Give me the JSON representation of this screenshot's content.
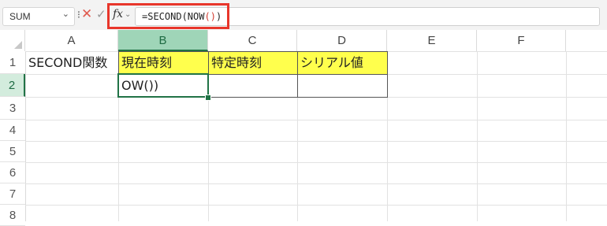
{
  "formula_bar": {
    "name_box": "SUM",
    "formula_prefix": "=SECOND(NOW",
    "formula_parens": "()",
    "formula_suffix": ")",
    "fx_label": "fx"
  },
  "columns": [
    "A",
    "B",
    "C",
    "D",
    "E",
    "F"
  ],
  "rows": [
    "1",
    "2",
    "3",
    "4",
    "5",
    "6",
    "7",
    "8"
  ],
  "cells": {
    "A1": "SECOND関数",
    "B1": "現在時刻",
    "C1": "特定時刻",
    "D1": "シリアル値",
    "B2": "OW())"
  },
  "colors": {
    "header_fill": "#ffff4d",
    "selection_green": "#217346",
    "highlight_box": "#e8362b"
  }
}
